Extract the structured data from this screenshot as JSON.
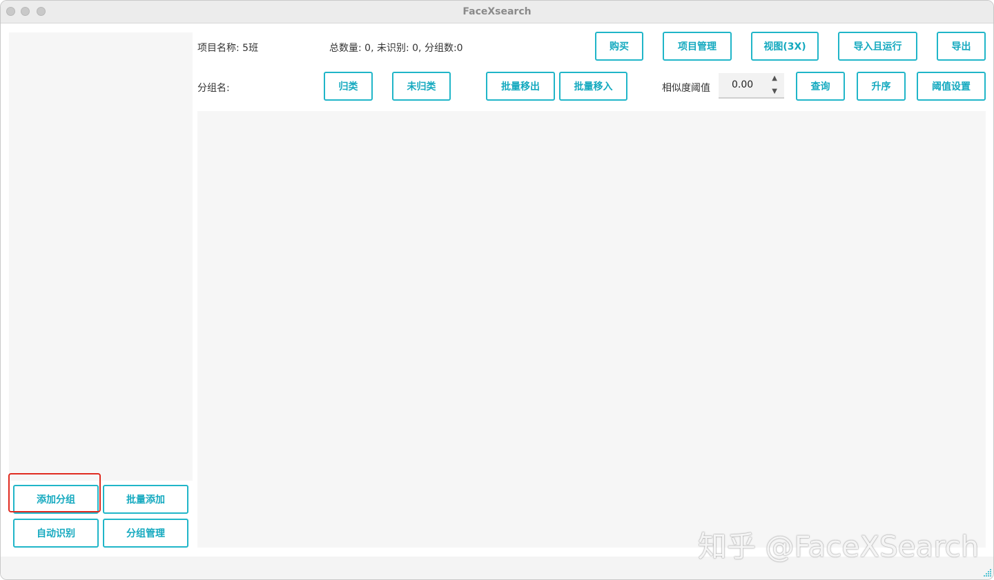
{
  "window": {
    "title": "FaceXsearch"
  },
  "header": {
    "project_label": "项目名称: 5班",
    "stats": "总数量: 0, 未识别: 0, 分组数:0",
    "group_name_label": "分组名:"
  },
  "toolbar_top": {
    "buy": "购买",
    "project_manage": "项目管理",
    "view": "视图(3X)",
    "import_run": "导入且运行",
    "export": "导出"
  },
  "toolbar_second": {
    "classify": "归类",
    "unclassified": "未归类",
    "batch_move_out": "批量移出",
    "batch_move_in": "批量移入",
    "threshold_label": "相似度阈值",
    "threshold_value": "0.00",
    "query": "查询",
    "ascending": "升序",
    "threshold_settings": "阈值设置"
  },
  "sidebar": {
    "add_group": "添加分组",
    "batch_add": "批量添加",
    "auto_recognize": "自动识别",
    "group_manage": "分组管理"
  },
  "watermark": "知乎 @FaceXSearch",
  "colors": {
    "accent": "#1fb5c8",
    "highlight": "#e02a1f",
    "panel": "#f6f6f6"
  }
}
